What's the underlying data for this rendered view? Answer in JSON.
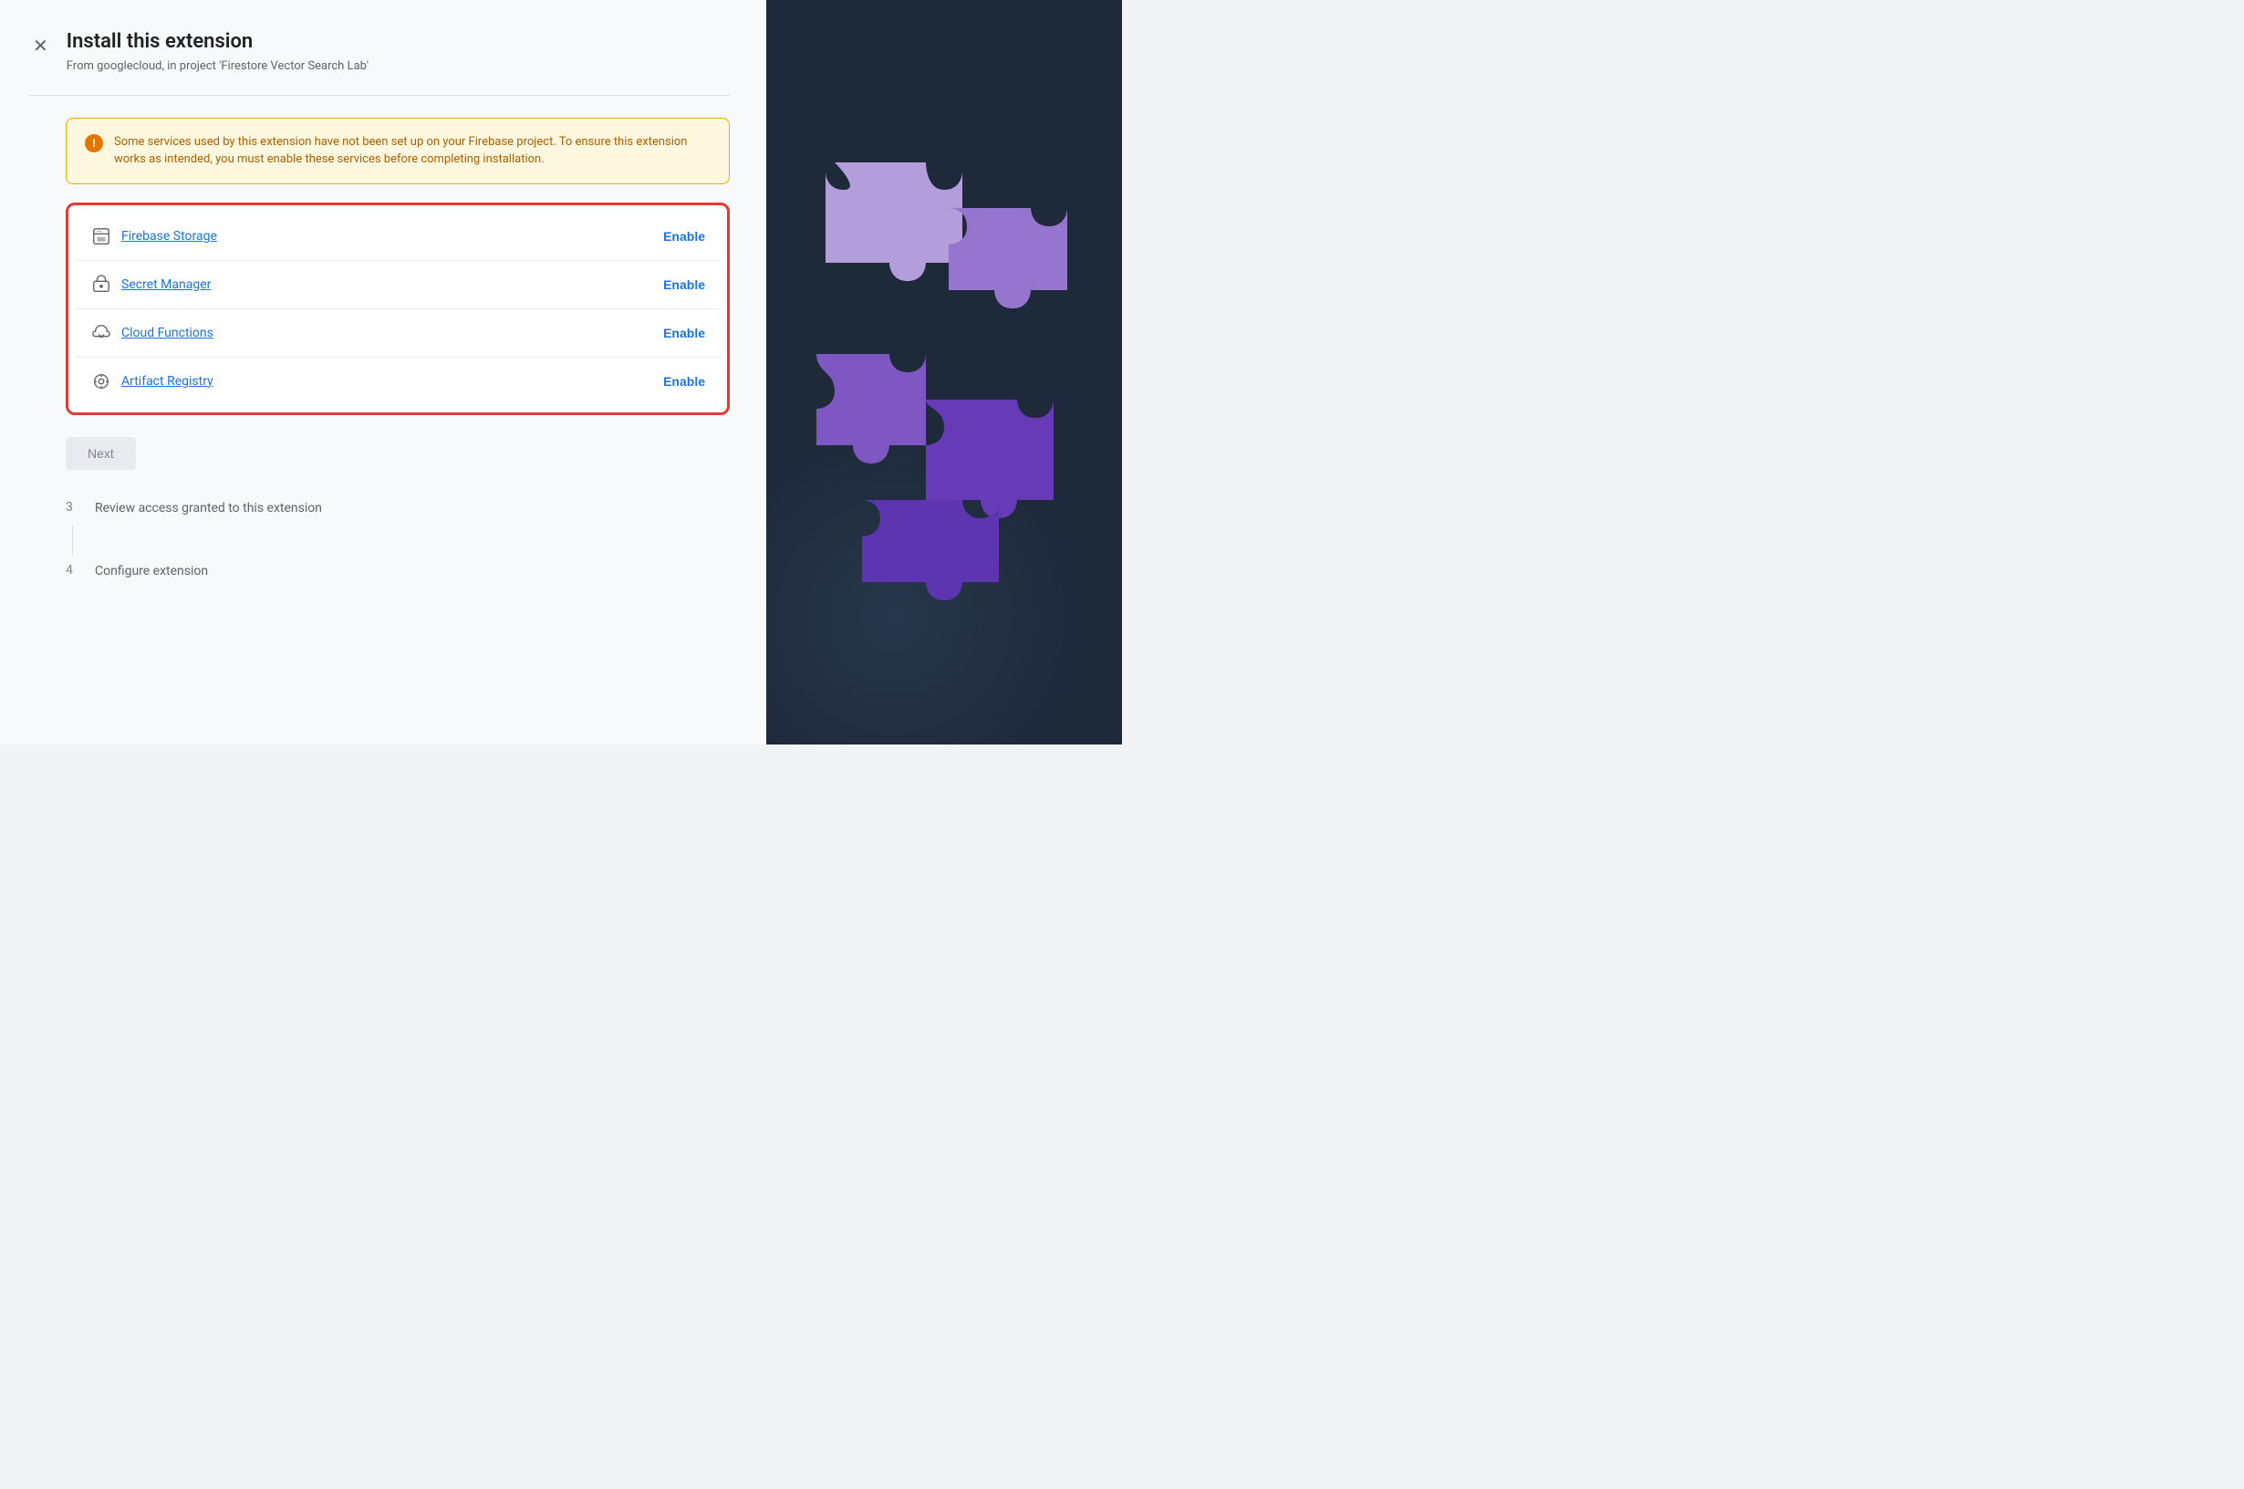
{
  "header": {
    "title": "Install this extension",
    "subtitle": "From googlecloud, in project 'Firestore Vector Search Lab'",
    "close_label": "×"
  },
  "warning": {
    "message": "Some services used by this extension have not been set up on your Firebase project. To ensure this extension works as intended, you must enable these services before completing installation."
  },
  "services": [
    {
      "id": "firebase-storage",
      "name": "Firebase Storage",
      "enable_label": "Enable",
      "icon": "image"
    },
    {
      "id": "secret-manager",
      "name": "Secret Manager",
      "enable_label": "Enable",
      "icon": "key"
    },
    {
      "id": "cloud-functions",
      "name": "Cloud Functions",
      "enable_label": "Enable",
      "icon": "functions"
    },
    {
      "id": "artifact-registry",
      "name": "Artifact Registry",
      "enable_label": "Enable",
      "icon": "registry"
    }
  ],
  "next_button": {
    "label": "Next"
  },
  "steps": [
    {
      "number": "3",
      "label": "Review access granted to this extension"
    },
    {
      "number": "4",
      "label": "Configure extension"
    }
  ]
}
